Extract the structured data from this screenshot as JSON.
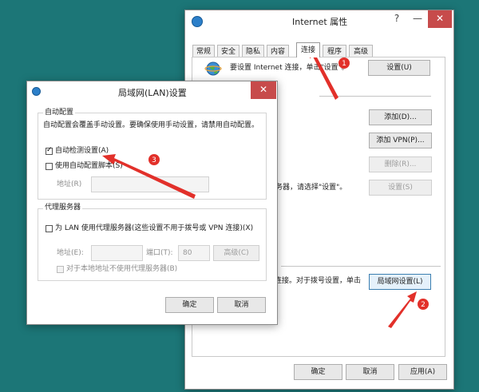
{
  "internet_window": {
    "title": "Internet 属性",
    "help_glyph": "?",
    "min_glyph": "—",
    "close_glyph": "✕",
    "tabs": [
      "常规",
      "安全",
      "隐私",
      "内容",
      "连接",
      "程序",
      "高级"
    ],
    "active_tab": "连接",
    "setup_text": "要设置 Internet 连接，单击\"设置\"。",
    "setup_button": "设置(U)",
    "add_button": "添加(D)...",
    "add_vpn_button": "添加 VPN(P)...",
    "delete_button": "删除(R)...",
    "settings_text": "务器，请选择\"设置\"。",
    "settings_button": "设置(S)",
    "lan_text": "连接。对于拨号设置，单击",
    "lan_button": "局域网设置(L)",
    "ok": "确定",
    "cancel": "取消",
    "apply": "应用(A)"
  },
  "lan_dialog": {
    "title": "局域网(LAN)设置",
    "close_glyph": "✕",
    "auto_group": "自动配置",
    "auto_desc": "自动配置会覆盖手动设置。要确保使用手动设置，请禁用自动配置。",
    "auto_detect": "自动检测设置(A)",
    "auto_detect_checked": true,
    "use_script": "使用自动配置脚本(S)",
    "use_script_checked": false,
    "address_label": "地址(R)",
    "proxy_group": "代理服务器",
    "use_proxy": "为 LAN 使用代理服务器(这些设置不用于拨号或 VPN 连接)(X)",
    "use_proxy_checked": false,
    "proxy_address_label": "地址(E):",
    "port_label": "端口(T):",
    "port_value": "80",
    "advanced_button": "高级(C)",
    "bypass_local": "对于本地地址不使用代理服务器(B)",
    "ok": "确定",
    "cancel": "取消"
  },
  "annotations": [
    "1",
    "2",
    "3"
  ],
  "colors": {
    "desktop": "#1c7677",
    "arrow": "#e2302a"
  }
}
